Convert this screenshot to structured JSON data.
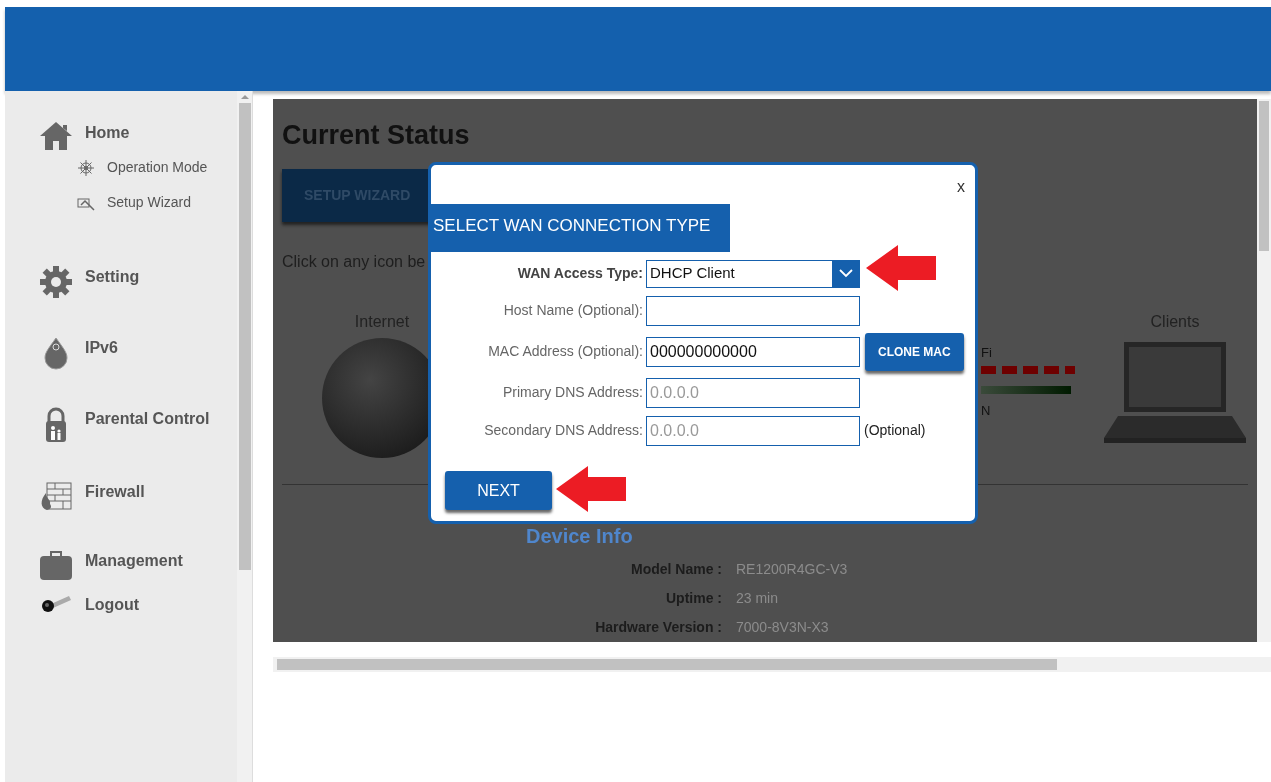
{
  "sidebar": {
    "items": [
      {
        "label": "Home",
        "children": [
          {
            "label": "Operation Mode"
          },
          {
            "label": "Setup Wizard"
          }
        ]
      },
      {
        "label": "Setting"
      },
      {
        "label": "IPv6"
      },
      {
        "label": "Parental Control"
      },
      {
        "label": "Firewall"
      },
      {
        "label": "Management"
      },
      {
        "label": "Logout"
      }
    ]
  },
  "page": {
    "title": "Current Status",
    "wizard_button": "SETUP WIZARD",
    "hint": "Click on any icon be",
    "internet_label": "Internet",
    "clients_label": "Clients",
    "wifi_label": "Fi",
    "lan_label": "N",
    "section_title": "Device Info",
    "info_rows": [
      {
        "label": "Model Name :",
        "value": "RE1200R4GC-V3"
      },
      {
        "label": "Uptime :",
        "value": "23 min"
      },
      {
        "label": "Hardware Version :",
        "value": "7000-8V3N-X3"
      }
    ]
  },
  "dialog": {
    "close": "x",
    "title": "SELECT WAN CONNECTION TYPE",
    "fields": [
      {
        "kind": "select",
        "label": "WAN Access Type:",
        "value": "DHCP Client"
      },
      {
        "kind": "text",
        "label": "Host Name (Optional):"
      },
      {
        "kind": "text",
        "label": "MAC Address (Optional):",
        "value": "000000000000",
        "button": "CLONE MAC"
      },
      {
        "kind": "text",
        "label": "Primary DNS Address:",
        "placeholder": "0.0.0.0"
      },
      {
        "kind": "text",
        "label": "Secondary DNS Address:",
        "placeholder": "0.0.0.0",
        "note": "(Optional)"
      }
    ],
    "next_button": "NEXT"
  }
}
